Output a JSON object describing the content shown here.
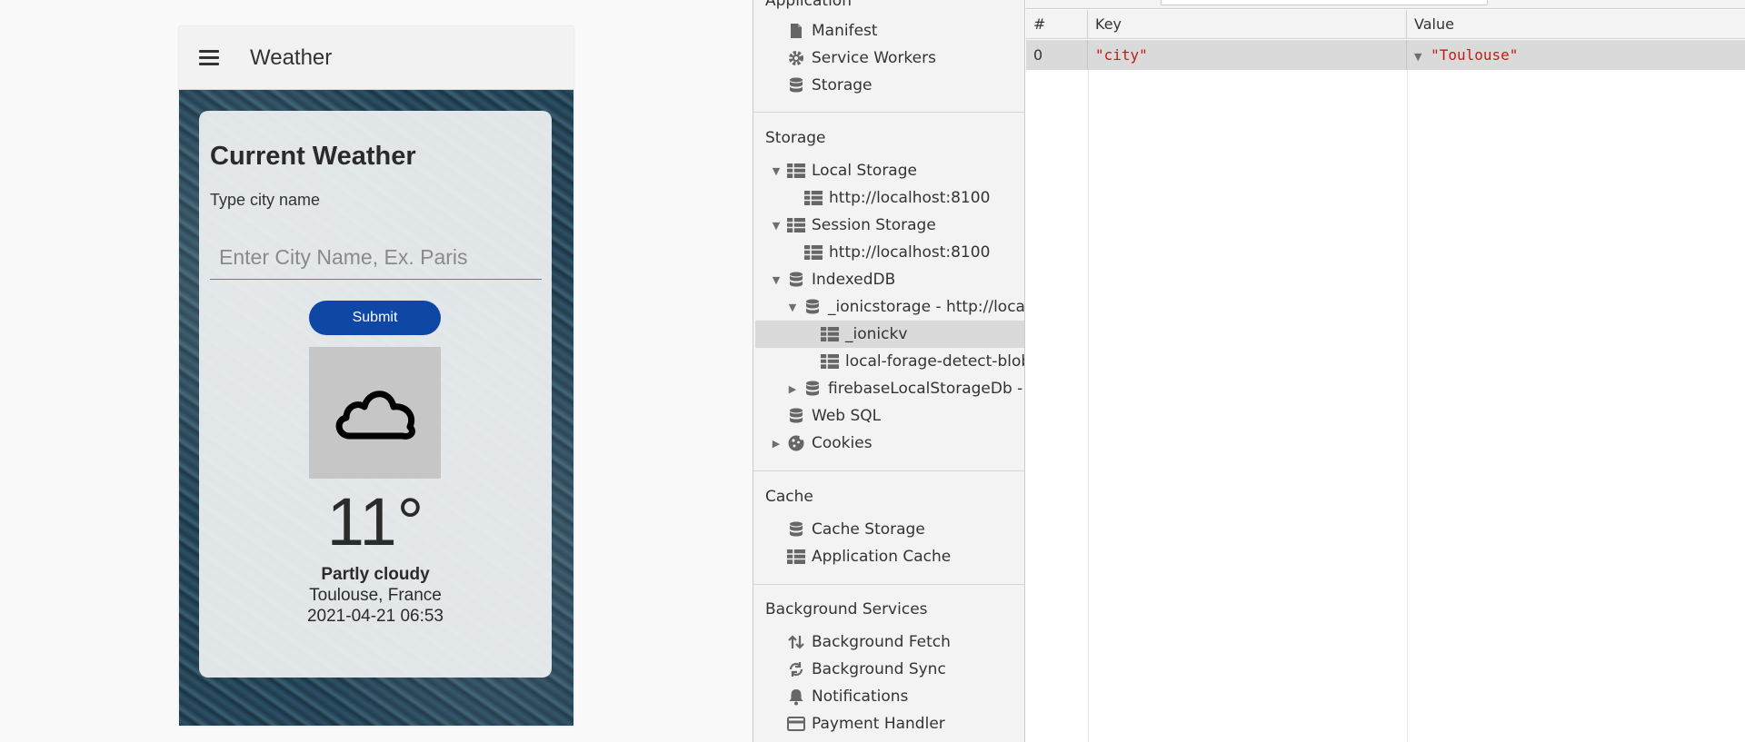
{
  "app": {
    "title": "Weather",
    "card_title": "Current Weather",
    "city_label": "Type city name",
    "city_placeholder": "Enter City Name, Ex. Paris",
    "submit_label": "Submit",
    "weather_icon": "cloud-icon",
    "temperature": "11°",
    "condition": "Partly cloudy",
    "location": "Toulouse, France",
    "datetime": "2021-04-21 06:53"
  },
  "devtools": {
    "top_section": "Application",
    "application_items": [
      {
        "label": "Manifest",
        "icon": "file-icon"
      },
      {
        "label": "Service Workers",
        "icon": "gear-icon"
      },
      {
        "label": "Storage",
        "icon": "database-icon"
      }
    ],
    "storage_section": "Storage",
    "storage": {
      "local_storage": "Local Storage",
      "local_storage_origin": "http://localhost:8100",
      "session_storage": "Session Storage",
      "session_storage_origin": "http://localhost:8100",
      "indexeddb": "IndexedDB",
      "ionic_db": "_ionicstorage - http://localh",
      "ionic_store": "_ionickv",
      "forage_store": "local-forage-detect-blob",
      "firebase_db": "firebaseLocalStorageDb - h",
      "web_sql": "Web SQL",
      "cookies": "Cookies"
    },
    "cache_section": "Cache",
    "cache_items": [
      {
        "label": "Cache Storage",
        "icon": "database-icon"
      },
      {
        "label": "Application Cache",
        "icon": "grid-icon"
      }
    ],
    "background_section": "Background Services",
    "background_items": [
      {
        "label": "Background Fetch",
        "icon": "up-down-arrows-icon"
      },
      {
        "label": "Background Sync",
        "icon": "sync-icon"
      },
      {
        "label": "Notifications",
        "icon": "bell-icon"
      },
      {
        "label": "Payment Handler",
        "icon": "card-icon"
      }
    ]
  },
  "table": {
    "columns": [
      "#",
      "Key",
      "Value"
    ],
    "rows": [
      {
        "index": "0",
        "key": "\"city\"",
        "value": "\"Toulouse\""
      }
    ]
  }
}
